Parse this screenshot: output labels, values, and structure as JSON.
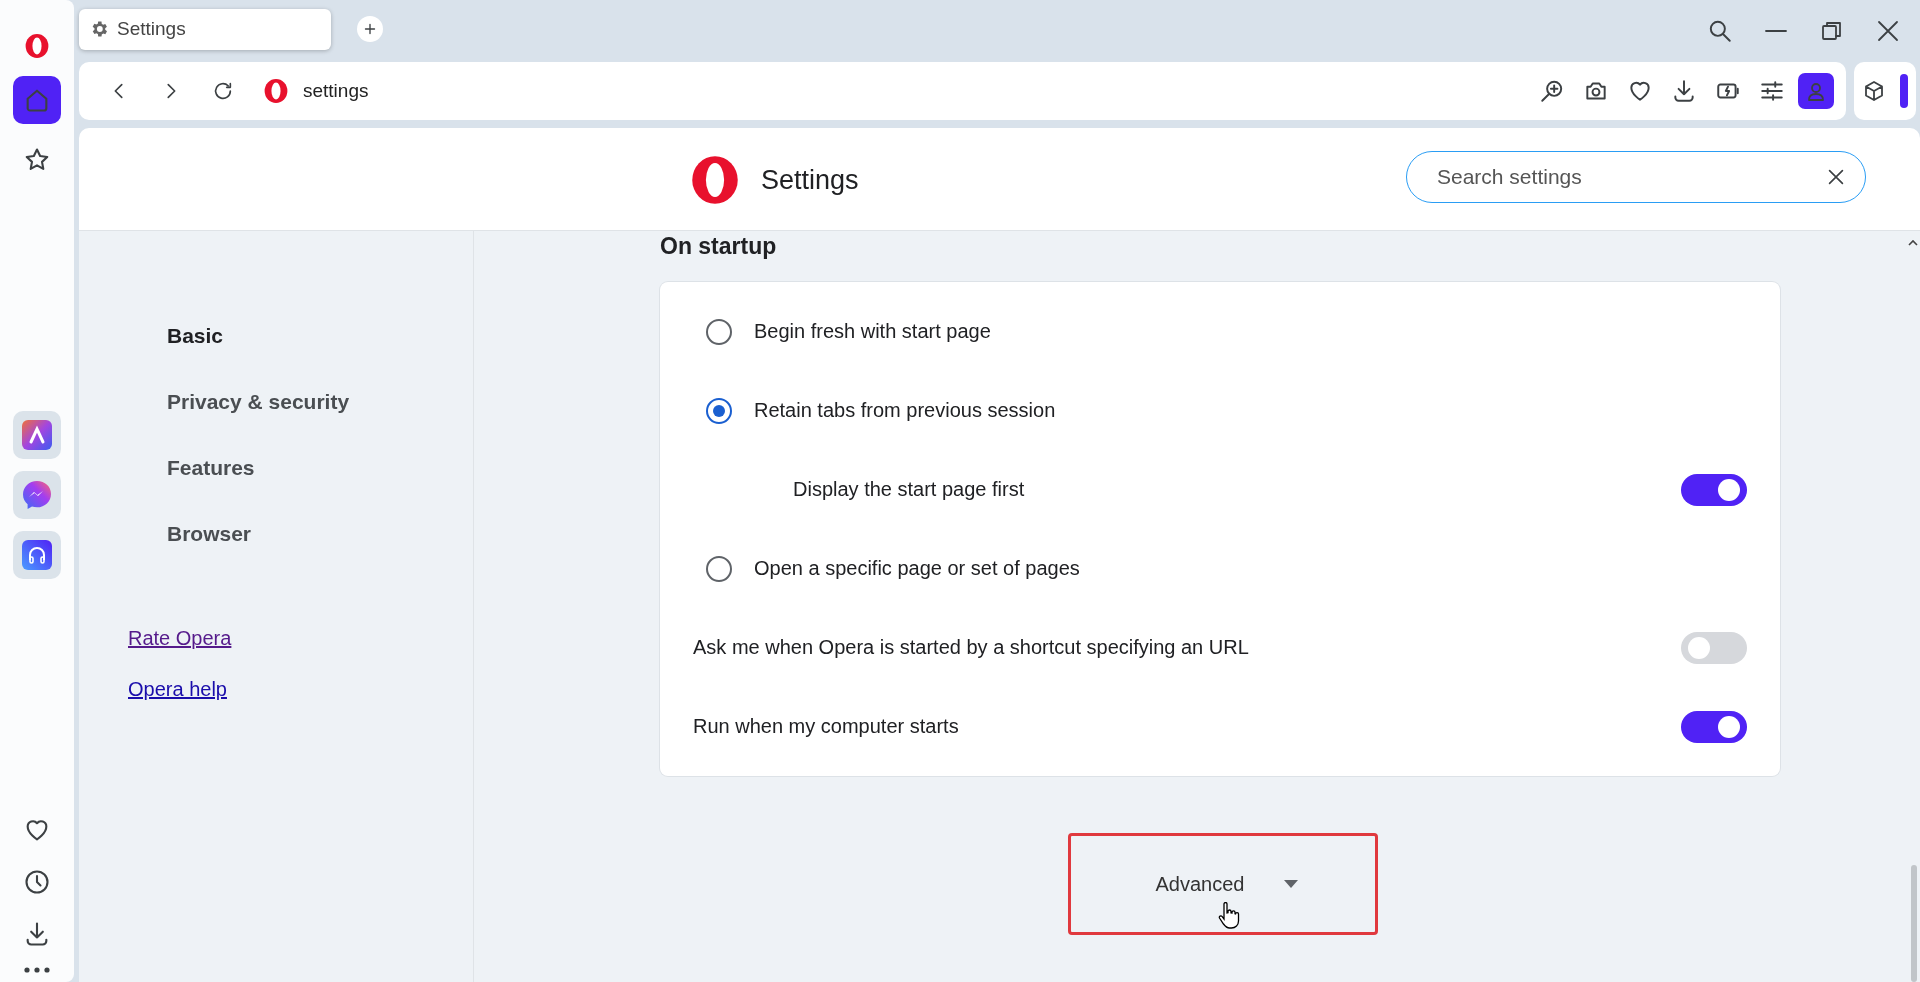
{
  "tabs": [
    {
      "label": "Settings",
      "selected": true
    }
  ],
  "address_bar": {
    "url": "settings"
  },
  "settings_header": {
    "title": "Settings",
    "search": {
      "placeholder": "Search settings"
    }
  },
  "nav": {
    "items": [
      {
        "label": "Basic",
        "selected": true
      },
      {
        "label": "Privacy & security",
        "selected": false
      },
      {
        "label": "Features",
        "selected": false
      },
      {
        "label": "Browser",
        "selected": false
      }
    ],
    "links": [
      {
        "label": "Rate Opera",
        "visited": true
      },
      {
        "label": "Opera help",
        "visited": false
      }
    ]
  },
  "on_startup": {
    "title": "On startup",
    "options": [
      {
        "kind": "radio",
        "label": "Begin fresh with start page",
        "selected": false
      },
      {
        "kind": "radio",
        "label": "Retain tabs from previous session",
        "selected": true,
        "children": [
          {
            "kind": "toggle",
            "label": "Display the start page first",
            "on": true
          }
        ]
      },
      {
        "kind": "radio",
        "label": "Open a specific page or set of pages",
        "selected": false
      },
      {
        "kind": "toggle",
        "label": "Ask me when Opera is started by a shortcut specifying an URL",
        "on": false
      },
      {
        "kind": "toggle",
        "label": "Run when my computer starts",
        "on": true
      }
    ]
  },
  "advanced": {
    "label": "Advanced"
  }
}
